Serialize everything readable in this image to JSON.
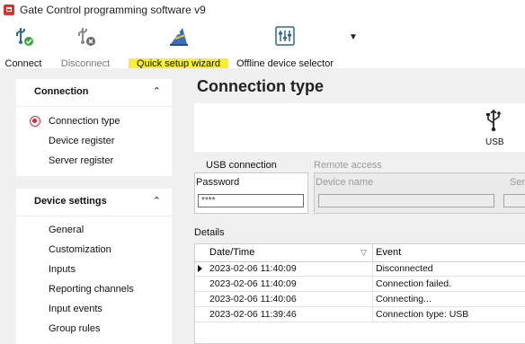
{
  "window": {
    "title": "Gate Control programming software v9"
  },
  "toolbar": {
    "connect": "Connect",
    "disconnect": "Disconnect",
    "wizard": "Quick setup wizard",
    "offline": "Offline device selector",
    "more": "▼"
  },
  "sidebar": {
    "connection": {
      "title": "Connection",
      "chevron": "⌃",
      "items": [
        {
          "label": "Connection type",
          "selected": true
        },
        {
          "label": "Device register"
        },
        {
          "label": "Server register"
        }
      ]
    },
    "device_settings": {
      "title": "Device settings",
      "chevron": "⌃",
      "items": [
        {
          "label": "General"
        },
        {
          "label": "Customization"
        },
        {
          "label": "Inputs"
        },
        {
          "label": "Reporting channels"
        },
        {
          "label": "Input events"
        },
        {
          "label": "Group rules"
        }
      ]
    }
  },
  "main": {
    "title": "Connection type",
    "connection_icon": "usb-icon",
    "connection_label": "USB",
    "tabs": [
      {
        "label": "USB connection",
        "active": true
      },
      {
        "label": "Remote access",
        "active": false
      }
    ],
    "password": {
      "label": "Password",
      "value": "****"
    },
    "remote": {
      "device_name_label": "Device name",
      "server_label": "Serve"
    },
    "details": {
      "label": "Details",
      "columns": [
        "Date/Time",
        "Event"
      ],
      "rows": [
        {
          "datetime": "2023-02-06 11:40:09",
          "event": "Disconnected"
        },
        {
          "datetime": "2023-02-06 11:40:09",
          "event": "Connection failed."
        },
        {
          "datetime": "2023-02-06 11:40:06",
          "event": "Connecting..."
        },
        {
          "datetime": "2023-02-06 11:39:46",
          "event": "Connection type: USB"
        }
      ]
    }
  },
  "colors": {
    "accent": "#d4283a",
    "highlight": "#f7ef2f"
  }
}
